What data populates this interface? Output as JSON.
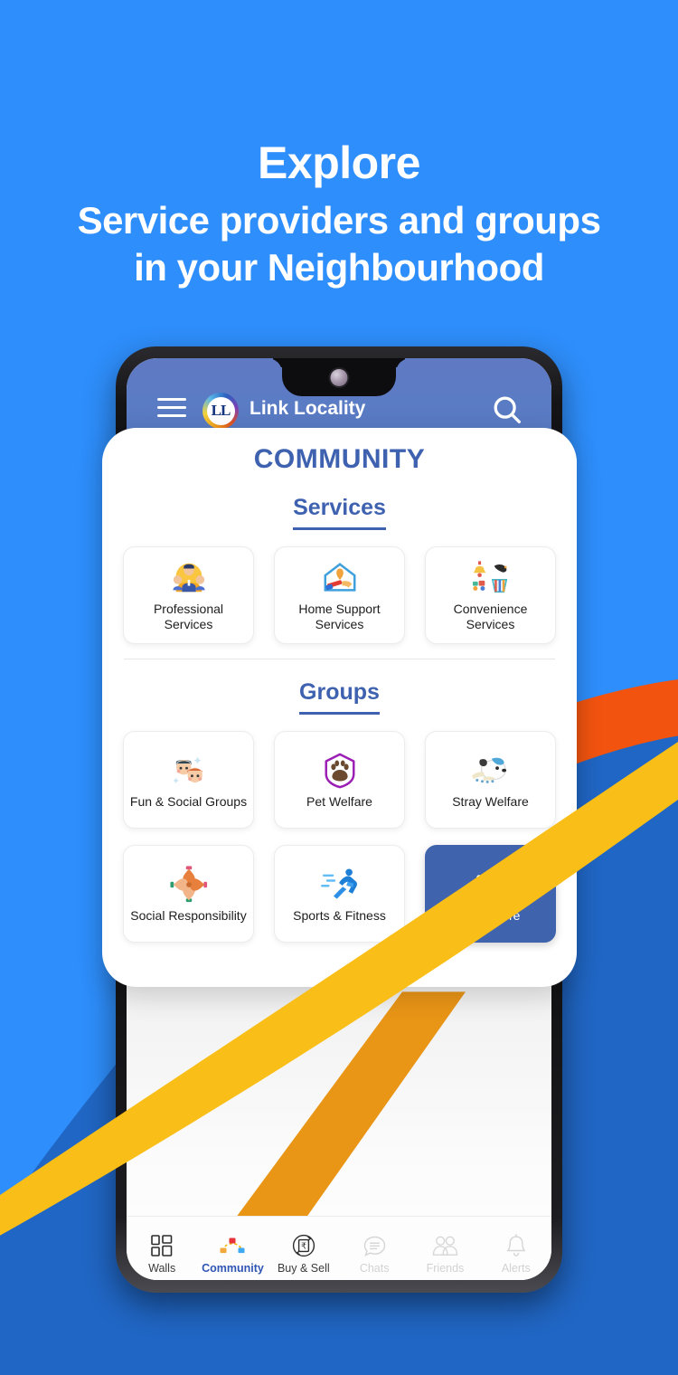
{
  "colors": {
    "bg_light_blue": "#2E8EFB",
    "bg_dark_blue": "#2066C4",
    "accent_orange": "#F25410",
    "accent_yellow": "#F9BE17",
    "heading_blue": "#3E62B0",
    "appbar_blue": "#5A7CC4",
    "primary_button": "#3F63AD"
  },
  "headline": {
    "line1": "Explore",
    "line2": "Service providers and groups",
    "line3": "in your Neighbourhood"
  },
  "phone": {
    "app_bar": {
      "menu_icon": "hamburger-icon",
      "logo_text": "LL",
      "title": "Link Locality",
      "search_icon": "search-icon"
    },
    "card": {
      "title": "COMMUNITY",
      "sections": [
        {
          "heading": "Services",
          "tiles": [
            {
              "label": "Professional Services",
              "icon": "professional-services-icon",
              "primary": false
            },
            {
              "label": "Home Support Services",
              "icon": "home-support-icon",
              "primary": false
            },
            {
              "label": "Convenience Services",
              "icon": "convenience-services-icon",
              "primary": false
            }
          ]
        },
        {
          "heading": "Groups",
          "tiles": [
            {
              "label": "Fun & Social Groups",
              "icon": "fun-social-icon",
              "primary": false
            },
            {
              "label": "Pet Welfare",
              "icon": "pet-welfare-icon",
              "primary": false
            },
            {
              "label": "Stray Welfare",
              "icon": "stray-welfare-icon",
              "primary": false
            },
            {
              "label": "Social Responsibility",
              "icon": "social-responsibility-icon",
              "primary": false
            },
            {
              "label": "Sports & Fitness",
              "icon": "sports-fitness-icon",
              "primary": false
            },
            {
              "label": "View more",
              "icon": "double-chevron-right-icon",
              "primary": true
            }
          ]
        }
      ]
    },
    "bottom_nav": [
      {
        "label": "Walls",
        "icon": "grid-icon",
        "state": "normal"
      },
      {
        "label": "Community",
        "icon": "community-icon",
        "state": "active"
      },
      {
        "label": "Buy & Sell",
        "icon": "rupee-exchange-icon",
        "state": "normal"
      },
      {
        "label": "Chats",
        "icon": "chat-bubble-icon",
        "state": "dim"
      },
      {
        "label": "Friends",
        "icon": "friends-icon",
        "state": "dim"
      },
      {
        "label": "Alerts",
        "icon": "bell-icon",
        "state": "dim"
      }
    ]
  }
}
